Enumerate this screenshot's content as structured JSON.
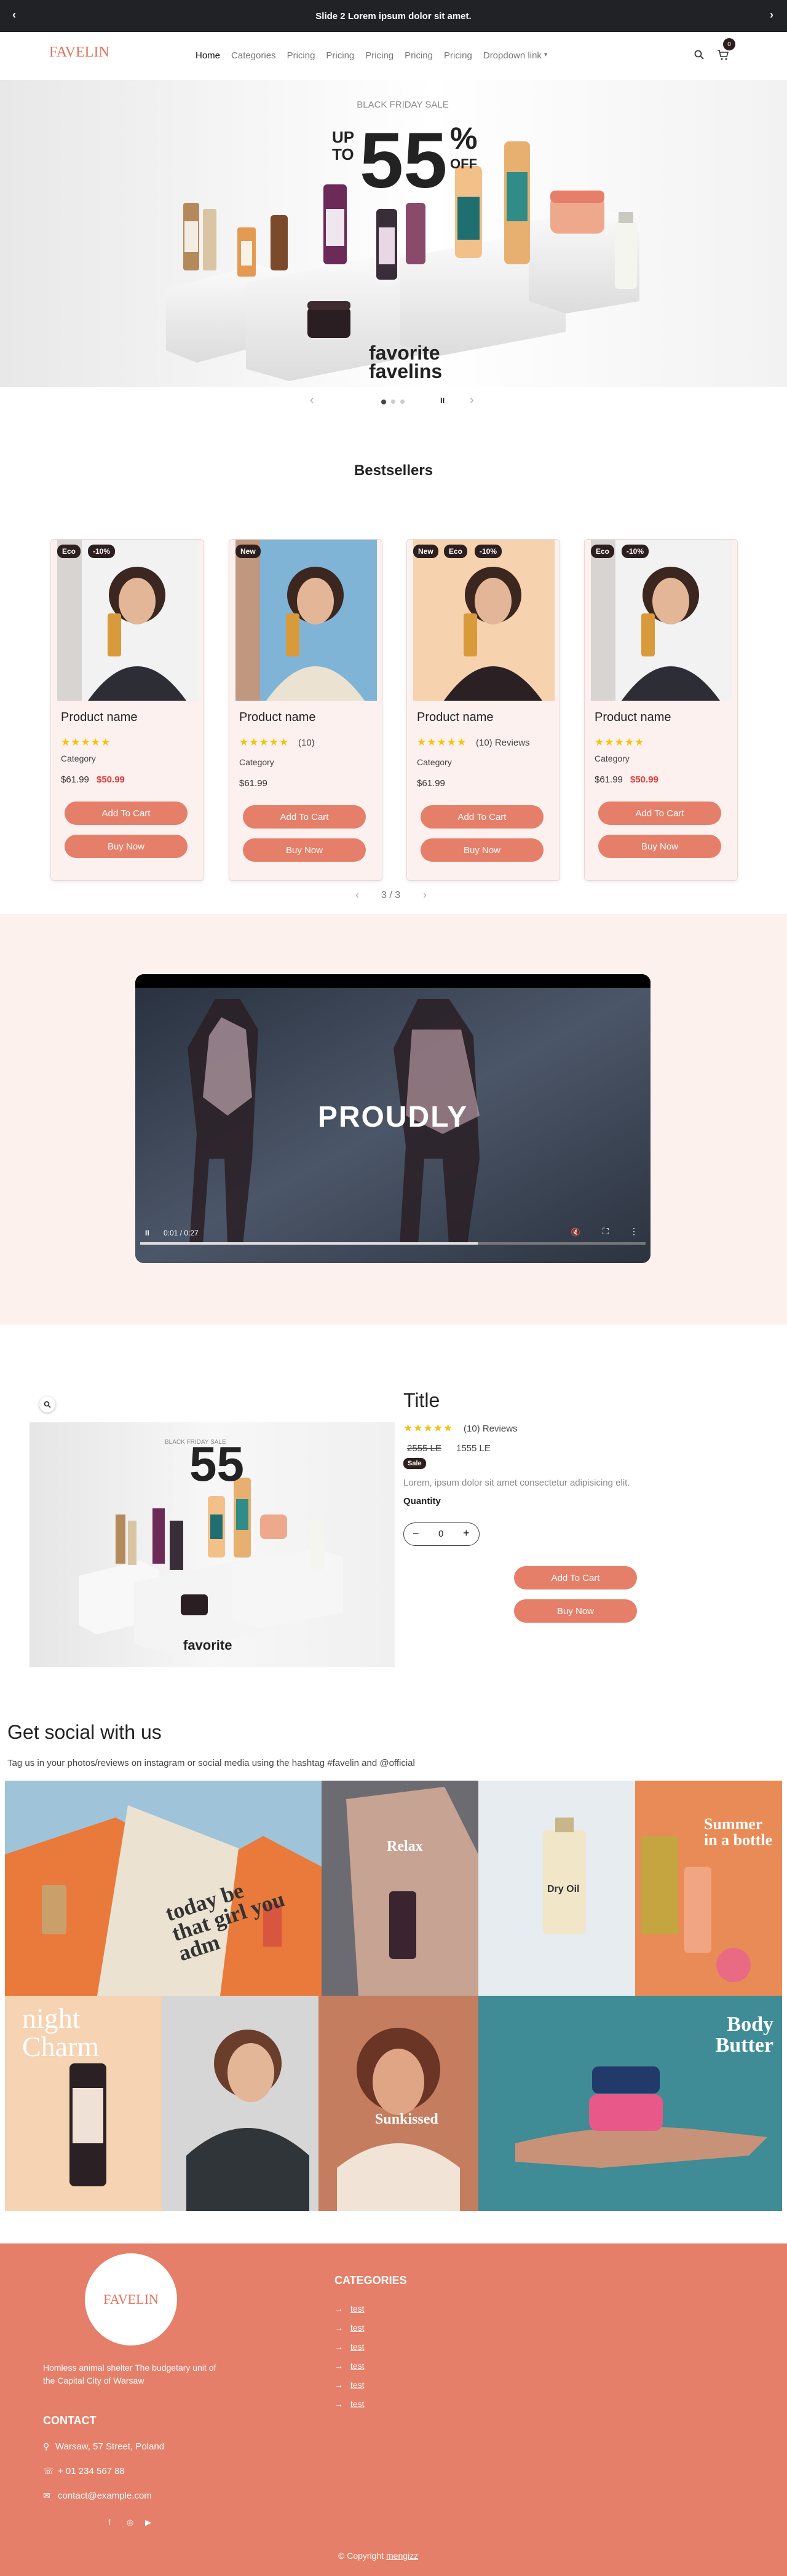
{
  "announcement": {
    "text": "Slide 2 Lorem ipsum dolor sit amet."
  },
  "brand": {
    "logo": "FAVELIN"
  },
  "nav": {
    "items": [
      "Home",
      "Categories",
      "Pricing",
      "Pricing",
      "Pricing",
      "Pricing",
      "Pricing",
      "Dropdown link"
    ],
    "cart_count": "0"
  },
  "hero": {
    "kicker": "BLACK FRIDAY SALE",
    "up": "UP",
    "to": "TO",
    "big": "55",
    "pct": "%",
    "off": "OFF",
    "brand_line1": "favorite",
    "brand_line2": "favelins",
    "pause": "II"
  },
  "bestsellers": {
    "title": "Bestsellers",
    "pagination": "3 / 3",
    "products": [
      {
        "badges": [
          "Eco",
          "-10%"
        ],
        "name": "Product name",
        "reviews": "",
        "category": "Category",
        "price": "$61.99",
        "sale": "$50.99",
        "add": "Add To Cart",
        "buy": "Buy Now"
      },
      {
        "badges": [
          "New"
        ],
        "name": "Product name",
        "reviews": "(10)",
        "category": "Category",
        "price": "$61.99",
        "sale": "",
        "add": "Add To Cart",
        "buy": "Buy Now"
      },
      {
        "badges": [
          "New",
          "Eco",
          "-10%"
        ],
        "name": "Product name",
        "reviews": "(10) Reviews",
        "category": "Category",
        "price": "$61.99",
        "sale": "",
        "add": "Add To Cart",
        "buy": "Buy Now"
      },
      {
        "badges": [
          "Eco",
          "-10%"
        ],
        "name": "Product name",
        "reviews": "",
        "category": "Category",
        "price": "$61.99",
        "sale": "$50.99",
        "add": "Add To Cart",
        "buy": "Buy Now"
      }
    ]
  },
  "video": {
    "overlay": "PROUDLY",
    "time": "0:01 / 0:27",
    "progress": 0.06
  },
  "product": {
    "title": "Title",
    "reviews": "(10) Reviews",
    "old_price": "2555 LE",
    "price": "1555 LE",
    "sale_badge": "Sale",
    "desc": "Lorem, ipsum dolor sit amet consectetur adipisicing elit.",
    "qty_label": "Quantity",
    "qty": "0",
    "minus": "−",
    "plus": "+",
    "add": "Add To Cart",
    "buy": "Buy Now"
  },
  "social": {
    "title": "Get social with us",
    "subtitle": "Tag us in your photos/reviews on instagram or social media using the hashtag #favelin and @official",
    "tile_texts": [
      "today be that girl you adm",
      "Relax",
      "Dry Oil",
      "Summer in a bottle",
      "night Charm",
      "Sunkissed",
      "Body Butter"
    ]
  },
  "footer": {
    "tagline": "Homless animal shelter The budgetary unit of the Capital City of Warsaw",
    "contact_title": "CONTACT",
    "address": "Warsaw, 57 Street, Poland",
    "phone": "+ 01 234 567 88",
    "email": "contact@example.com",
    "categories_title": "CATEGORIES",
    "links": [
      "test",
      "test",
      "test",
      "test",
      "test",
      "test"
    ],
    "copyright": "© Copyright",
    "author": "mengizz"
  },
  "colors": {
    "accent": "#e57f69",
    "dark": "#202226",
    "blush": "#fdf1ee",
    "star": "#f1c40f"
  }
}
